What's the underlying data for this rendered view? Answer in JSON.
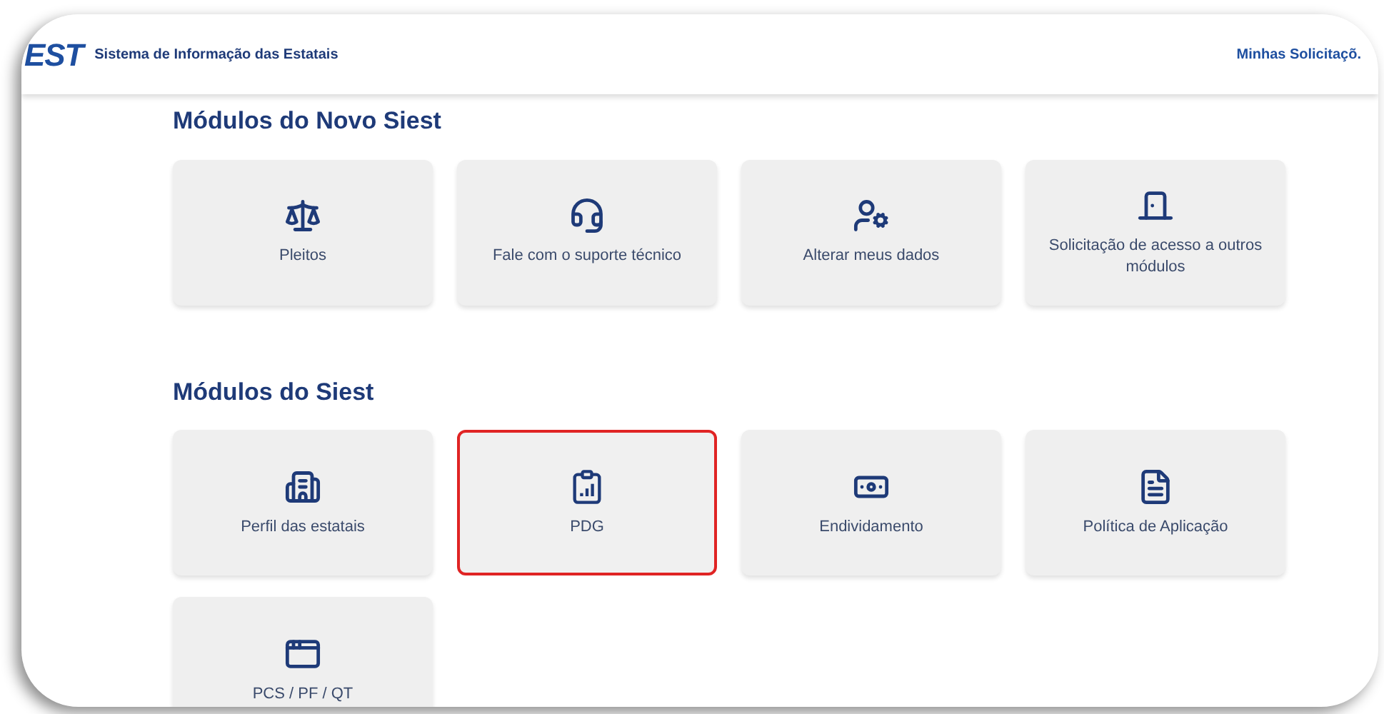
{
  "header": {
    "logo": "EST",
    "title": "Sistema de Informação das Estatais",
    "link": "Minhas Solicitaçõ."
  },
  "sections": [
    {
      "title": "Módulos do Novo Siest",
      "modules": [
        {
          "label": "Pleitos",
          "highlighted": false
        },
        {
          "label": "Fale com o suporte técnico",
          "highlighted": false
        },
        {
          "label": "Alterar meus dados",
          "highlighted": false
        },
        {
          "label": "Solicitação de acesso a outros módulos",
          "highlighted": false
        }
      ]
    },
    {
      "title": "Módulos do Siest",
      "modules": [
        {
          "label": "Perfil das estatais",
          "highlighted": false
        },
        {
          "label": "PDG",
          "highlighted": true
        },
        {
          "label": "Endividamento",
          "highlighted": false
        },
        {
          "label": "Política de Aplicação",
          "highlighted": false
        },
        {
          "label": "PCS / PF / QT",
          "highlighted": false
        }
      ]
    }
  ]
}
